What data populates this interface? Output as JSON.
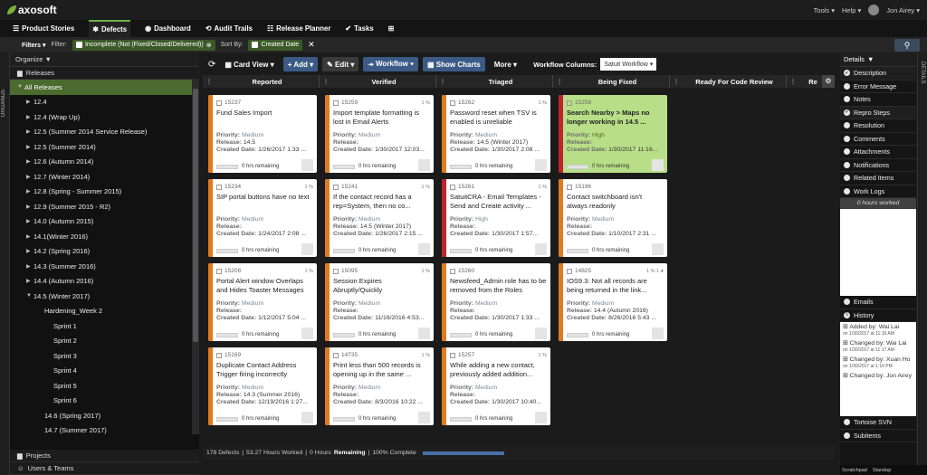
{
  "app": {
    "logo": "axosoft",
    "tools": "Tools ▾",
    "help": "Help ▾",
    "user": "Jon Airey ▾"
  },
  "nav": [
    {
      "label": "Product Stories",
      "icon": "☰"
    },
    {
      "label": "Defects",
      "icon": "✱"
    },
    {
      "label": "Dashboard",
      "icon": "◉"
    },
    {
      "label": "Audit Trails",
      "icon": "⟲"
    },
    {
      "label": "Release Planner",
      "icon": "☷"
    },
    {
      "label": "Tasks",
      "icon": "✔"
    }
  ],
  "filters": {
    "filters_label": "Filters ▾",
    "filter_label": "Filter:",
    "filter_value": "Incomplete (Not (Fixed/Closed/Delivered))",
    "sortby_label": "Sort By:",
    "sortby_value": "Created Date"
  },
  "sidebar": {
    "tab": "ORGANIZE",
    "organize": "Organize",
    "releases": "Releases",
    "all_releases": "All Releases",
    "tree": [
      {
        "label": "12.4",
        "level": 1
      },
      {
        "label": "12.4 (Wrap Up)",
        "level": 1
      },
      {
        "label": "12.5 (Summer 2014 Service Release)",
        "level": 1
      },
      {
        "label": "12.5 (Summer 2014)",
        "level": 1
      },
      {
        "label": "12.6 (Autumn 2014)",
        "level": 1
      },
      {
        "label": "12.7 (Winter 2014)",
        "level": 1
      },
      {
        "label": "12.8 (Spring - Summer 2015)",
        "level": 1
      },
      {
        "label": "12.9 (Summer 2015 - R2)",
        "level": 1
      },
      {
        "label": "14.0 (Autumn 2015)",
        "level": 1
      },
      {
        "label": "14.1(Winter 2016)",
        "level": 1
      },
      {
        "label": "14.2 (Spring 2016)",
        "level": 1
      },
      {
        "label": "14.3 (Summer 2016)",
        "level": 1
      },
      {
        "label": "14.4 (Autumn 2016)",
        "level": 1
      },
      {
        "label": "14.5 (Winter 2017)",
        "level": 1,
        "expanded": true
      },
      {
        "label": "Hardening_Week 2",
        "level": 2
      },
      {
        "label": "Sprint 1",
        "level": 3
      },
      {
        "label": "Sprint 2",
        "level": 3
      },
      {
        "label": "Sprint 3",
        "level": 3
      },
      {
        "label": "Sprint 4",
        "level": 3
      },
      {
        "label": "Sprint 5",
        "level": 3
      },
      {
        "label": "Sprint 6",
        "level": 3
      },
      {
        "label": "14.6 (Spring 2017)",
        "level": 2
      },
      {
        "label": "14.7 (Summer 2017)",
        "level": 2
      }
    ],
    "projects": "Projects",
    "users_teams": "Users & Teams"
  },
  "toolbar": {
    "card_view": "Card View ▾",
    "add": "+ Add ▾",
    "edit": "✎ Edit ▾",
    "workflow": "⯮ Workflow ▾",
    "show_charts": "▦ Show Charts",
    "more": "More ▾",
    "workflow_columns": "Workflow Columns:",
    "workflow_value": "Satuit Workflow"
  },
  "columns": [
    "Reported",
    "Verified",
    "Triaged",
    "Being Fixed",
    "Ready For Code Review",
    "Re"
  ],
  "labels": {
    "priority": "Priority:",
    "release": "Release:",
    "created": "Created Date:",
    "remaining": "0 hrs remaining"
  },
  "cards": [
    {
      "col": 0,
      "row": 0,
      "id": "15237",
      "meta": "",
      "title": "Fund Sales Import",
      "priority": "Medium",
      "release": "14.5",
      "created": "1/26/2017 1:33 ...",
      "color": "#e07a1f"
    },
    {
      "col": 0,
      "row": 1,
      "id": "15234",
      "meta": "1 %",
      "title": "SIP portal buttons have no text",
      "priority": "Medium",
      "release": "",
      "created": "1/24/2017 2:08 ...",
      "color": "#e07a1f"
    },
    {
      "col": 0,
      "row": 2,
      "id": "15208",
      "meta": "1 %",
      "title": "Portal Alert window Overlaps and Hides Toaster Messages",
      "priority": "Medium",
      "release": "",
      "created": "1/12/2017 5:04 ...",
      "color": "#e07a1f"
    },
    {
      "col": 0,
      "row": 3,
      "id": "15169",
      "meta": "",
      "title": "Duplicate Contact Address Trigger firing incorrectly",
      "priority": "Medium",
      "release": "14.3 (Summer 2016)",
      "created": "12/19/2016 1:27...",
      "color": "#e07a1f"
    },
    {
      "col": 1,
      "row": 0,
      "id": "15259",
      "meta": "1 %",
      "title": "Import template formatting is lost in Email Alerts",
      "priority": "Medium",
      "release": "",
      "created": "1/30/2017 12:03...",
      "color": "#e07a1f"
    },
    {
      "col": 1,
      "row": 1,
      "id": "15241",
      "meta": "1 %",
      "title": "If the contact record has a rep=System, then no co...",
      "priority": "Medium",
      "release": "14.5 (Winter 2017)",
      "created": "1/26/2017 2:15 ...",
      "color": "#e07a1f"
    },
    {
      "col": 1,
      "row": 2,
      "id": "15095",
      "meta": "1 %",
      "title": "Session Expires Abruptly/Quickly",
      "priority": "Medium",
      "release": "",
      "created": "11/16/2016 4:53...",
      "color": "#e07a1f"
    },
    {
      "col": 1,
      "row": 3,
      "id": "14735",
      "meta": "1 %",
      "title": "Print less than 500 records is opening up in the same ...",
      "priority": "Medium",
      "release": "",
      "created": "8/3/2016 10:22 ...",
      "color": "#e07a1f"
    },
    {
      "col": 2,
      "row": 0,
      "id": "15262",
      "meta": "1 %",
      "title": "Password reset when TSV is enabled is unreliable",
      "priority": "Medium",
      "release": "14.5 (Winter 2017)",
      "created": "1/30/2017 2:08 ...",
      "color": "#e07a1f"
    },
    {
      "col": 2,
      "row": 1,
      "id": "15261",
      "meta": "1 %",
      "title": "SatuitCRA - Email Templates - Send and Create activity ...",
      "priority": "High",
      "release": "",
      "created": "1/30/2017 1:57...",
      "color": "#c0232a"
    },
    {
      "col": 2,
      "row": 2,
      "id": "15260",
      "meta": "",
      "title": "Newsfeed_Admin role has to be removed from the Roles",
      "priority": "Medium",
      "release": "",
      "created": "1/30/2017 1:33 ...",
      "color": "#e07a1f"
    },
    {
      "col": 2,
      "row": 3,
      "id": "15257",
      "meta": "1 %",
      "title": "While adding a new contact, previously added addition...",
      "priority": "Medium",
      "release": "",
      "created": "1/30/2017 10:40...",
      "color": "#e07a1f"
    },
    {
      "col": 3,
      "row": 0,
      "id": "15258",
      "meta": "",
      "title": "Search Nearby > Maps no longer working in 14.5 ...",
      "priority": "High",
      "release": "",
      "created": "1/30/2017 11:16...",
      "color": "#c0232a",
      "highlight": true
    },
    {
      "col": 3,
      "row": 1,
      "id": "15196",
      "meta": "",
      "title": "Contact switchboard isn't always readonly",
      "priority": "Medium",
      "release": "",
      "created": "1/10/2017 2:31 ...",
      "color": "#e07a1f"
    },
    {
      "col": 3,
      "row": 2,
      "id": "14825",
      "meta": "1 % 1 ●",
      "title": "IOS9.3: Not all records are being returned in the link...",
      "priority": "Medium",
      "release": "14.4 (Autumn 2016)",
      "created": "8/26/2016 5:43 ...",
      "color": "#e07a1f"
    }
  ],
  "status": {
    "defects": "178 Defects",
    "worked": "53.27 Hours Worked",
    "remaining_pre": "0 Hours",
    "remaining_bold": "Remaining",
    "complete": "100% Complete",
    "progress": 1.0
  },
  "details": {
    "title": "Details",
    "tab": "DETAILS",
    "items": [
      {
        "label": "Description",
        "checked": true
      },
      {
        "label": "Error Message",
        "checked": false
      },
      {
        "label": "Notes",
        "checked": false
      },
      {
        "label": "Repro Steps",
        "checked": true
      },
      {
        "label": "Resolution",
        "checked": false
      },
      {
        "label": "Comments",
        "checked": false
      },
      {
        "label": "Attachments",
        "checked": false
      },
      {
        "label": "Notifications",
        "checked": false
      },
      {
        "label": "Related Items",
        "checked": false
      },
      {
        "label": "Work Logs",
        "checked": false
      }
    ],
    "hours_worked": "0 hours worked",
    "emails": "Emails",
    "history": "History",
    "history_entries": [
      {
        "text": "⊞ Added by: Wai Lai",
        "when": "on 1/30/2017 at 11:16 AM"
      },
      {
        "text": "⊞ Changed by: Wai Lai",
        "when": "on 1/30/2017 at 11:17 AM"
      },
      {
        "text": "⊞ Changed by: Xuan Ho",
        "when": "on 1/30/2017 at 1:16 PM"
      },
      {
        "text": "⊞ Changed by: Jon Airey",
        "when": ""
      }
    ],
    "tortoise": "Tortoise SVN",
    "subitems": "Subitems",
    "scratchpad": "Scratchpad",
    "standup": "Standup"
  }
}
